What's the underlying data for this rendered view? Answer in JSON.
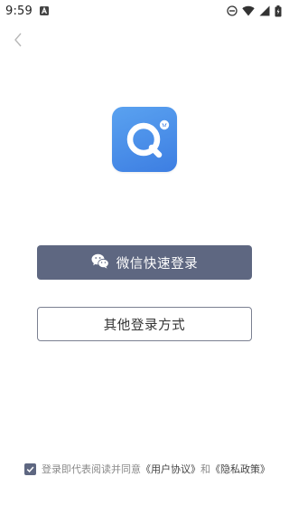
{
  "status_bar": {
    "time": "9:59",
    "left_icons": [
      "notification-a-icon"
    ],
    "right_icons": [
      "do-not-disturb-icon",
      "wifi-icon",
      "signal-icon",
      "battery-icon"
    ]
  },
  "navigation": {
    "back_icon": "chevron-left-icon"
  },
  "logo": {
    "icon": "q-logo-icon",
    "colors": {
      "gradient_start": "#5aa2f0",
      "gradient_end": "#3d7ee2"
    }
  },
  "buttons": {
    "wechat_login": {
      "label": "微信快速登录",
      "icon": "wechat-icon",
      "background": "#5e6781"
    },
    "other_login": {
      "label": "其他登录方式"
    }
  },
  "agreement": {
    "checked": true,
    "prefix": "登录即代表阅读并同意",
    "user_agreement": "《用户协议》",
    "conjunction": "和",
    "privacy_policy": "《隐私政策》"
  }
}
